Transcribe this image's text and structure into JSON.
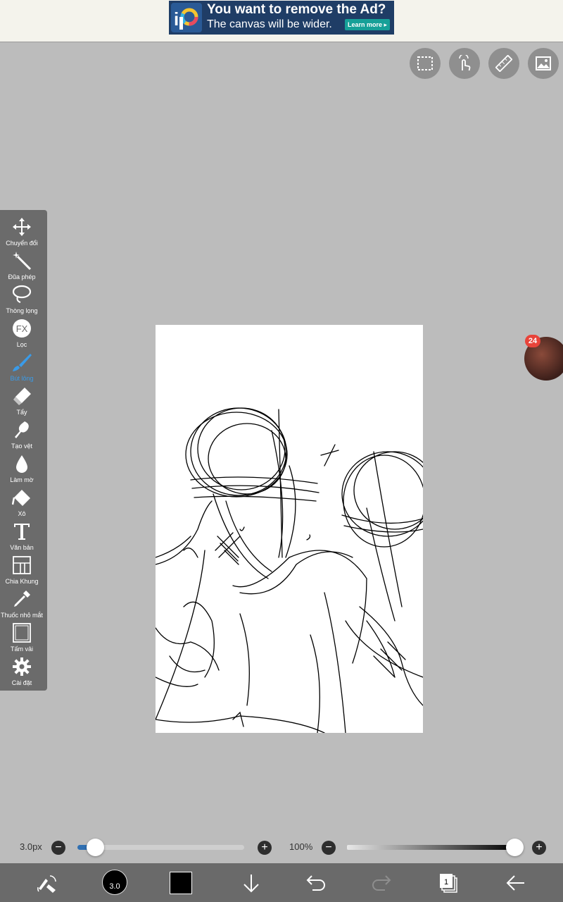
{
  "ad": {
    "title": "You want to remove the Ad?",
    "subtitle": "The canvas will be wider.",
    "button": "Learn more ▸",
    "logo_icon": "ibispaint-logo-icon"
  },
  "top_tools": [
    {
      "name": "selection-icon"
    },
    {
      "name": "touch-gesture-icon"
    },
    {
      "name": "ruler-icon"
    },
    {
      "name": "image-icon"
    }
  ],
  "tools": [
    {
      "label": "Chuyển đổi",
      "icon": "move-arrows-icon"
    },
    {
      "label": "Đũa phép",
      "icon": "magic-wand-icon"
    },
    {
      "label": "Thòng lọng",
      "icon": "lasso-icon"
    },
    {
      "label": "Lọc",
      "icon": "fx-filter-icon"
    },
    {
      "label": "Bút lông",
      "icon": "brush-icon",
      "active": true
    },
    {
      "label": "Tẩy",
      "icon": "eraser-icon"
    },
    {
      "label": "Tạo vệt",
      "icon": "smudge-icon"
    },
    {
      "label": "Làm mờ",
      "icon": "blur-drop-icon"
    },
    {
      "label": "Xô",
      "icon": "bucket-icon"
    },
    {
      "label": "Văn bản",
      "icon": "text-icon"
    },
    {
      "label": "Chia Khung",
      "icon": "frame-divider-icon"
    },
    {
      "label": "Thuốc nhỏ mắt",
      "icon": "eyedropper-icon"
    },
    {
      "label": "Tấm vải",
      "icon": "canvas-icon"
    },
    {
      "label": "Cài đặt",
      "icon": "gear-icon"
    }
  ],
  "notification_count": "24",
  "brush": {
    "size_label": "3.0px",
    "size_fraction": 0.1,
    "opacity_label": "100%",
    "opacity_fraction": 1.0
  },
  "bottom": {
    "brush_size": "3.0",
    "color": "#000000",
    "layer_count": "1"
  },
  "colors": {
    "accent": "#3a9be8",
    "panel": "#6b6b6b",
    "background": "#bcbcbc"
  }
}
